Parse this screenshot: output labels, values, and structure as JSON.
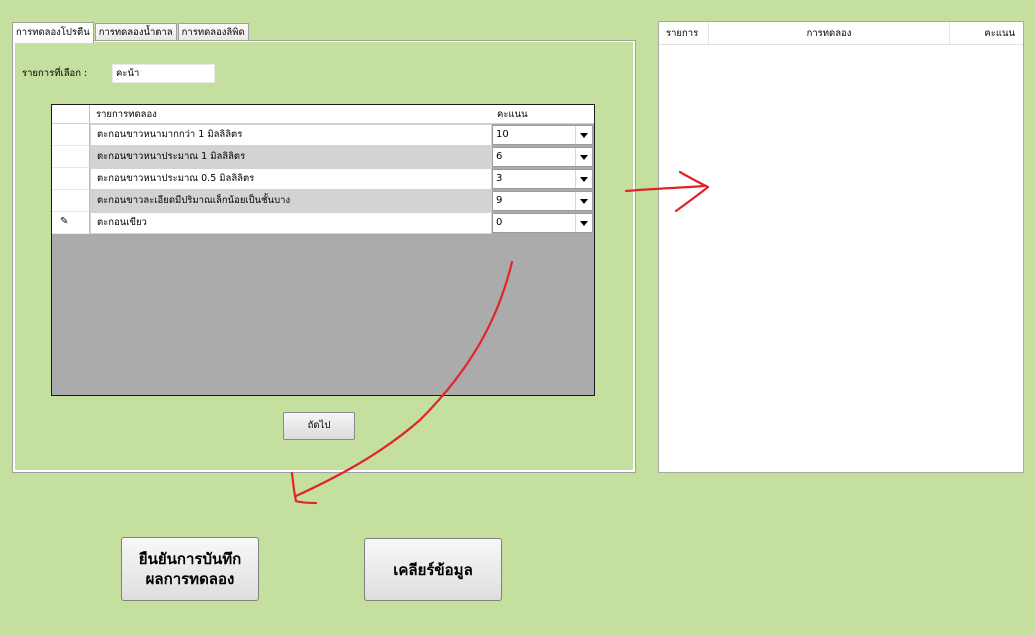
{
  "tabs": [
    {
      "label": "การทดลองโปรตีน",
      "active": true
    },
    {
      "label": "การทดลองน้ำตาล",
      "active": false
    },
    {
      "label": "การทดลองลิพิด",
      "active": false
    }
  ],
  "selection": {
    "label": "รายการที่เลือก :",
    "value": "คะน้า"
  },
  "grid": {
    "headers": {
      "name": "รายการทดลอง",
      "score": "คะแนน"
    },
    "rows": [
      {
        "name": "ตะกอนขาวหนามากกว่า 1 มิลลิลิตร",
        "score": "10"
      },
      {
        "name": "ตะกอนขาวหนาประมาณ 1 มิลลิลิตร",
        "score": "6"
      },
      {
        "name": "ตะกอนขาวหนาประมาณ 0.5 มิลลิลิตร",
        "score": "3"
      },
      {
        "name": "ตะกอนขาวละเอียดมีปริมาณเล็กน้อยเป็นชั้นบาง",
        "score": "9"
      },
      {
        "name": "ตะกอนเขียว",
        "score": "0"
      }
    ],
    "edit_row_icon": "pencil-icon",
    "edit_row_glyph": "✎"
  },
  "next_button": {
    "label": "ถัดไป"
  },
  "results_list": {
    "headers": {
      "item": "รายการ",
      "experiment": "การทดลอง",
      "score": "คะแนน"
    }
  },
  "buttons": {
    "confirm_line1": "ยืนยันการบันทึก",
    "confirm_line2": "ผลการทดลอง",
    "clear": "เคลียร์ข้อมูล"
  },
  "colors": {
    "background": "#c5df9f",
    "annotation_arrow": "#e0242a",
    "grid_empty": "#ababab"
  }
}
